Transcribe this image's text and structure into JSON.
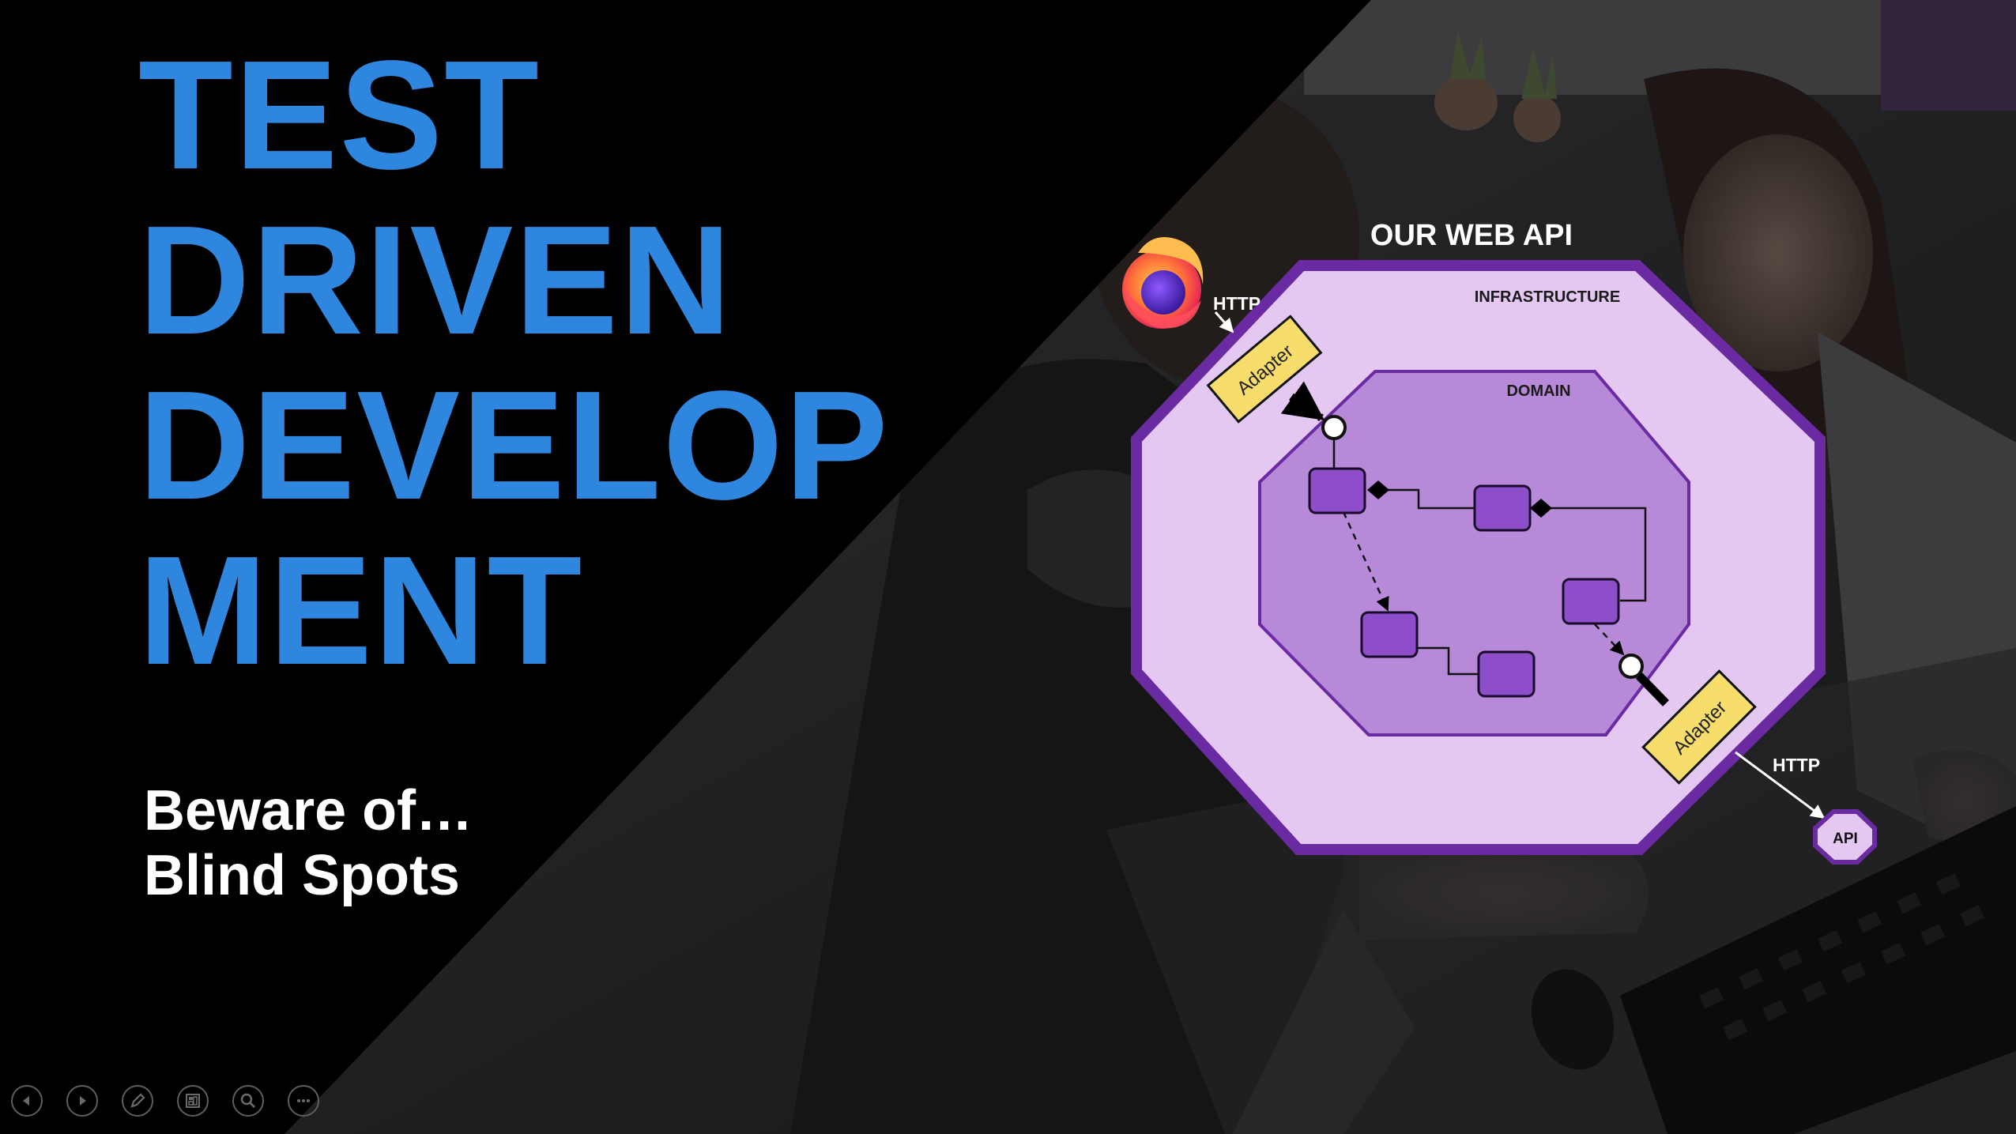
{
  "slide": {
    "title_lines": [
      "TEST",
      "DRIVEN",
      "DEVELOP",
      "MENT"
    ],
    "subtitle_lines": [
      "Beware of…",
      "Blind Spots"
    ]
  },
  "diagram": {
    "heading": "OUR WEB API",
    "outer_label": "INFRASTRUCTURE",
    "inner_label": "DOMAIN",
    "adapter_in_label": "Adapter",
    "adapter_out_label": "Adapter",
    "http_in_label": "HTTP",
    "http_out_label": "HTTP",
    "external_api_label": "API",
    "browser_icon": "firefox-icon"
  },
  "controls": [
    {
      "name": "previous-slide-button",
      "icon": "arrow-left-icon"
    },
    {
      "name": "next-slide-button",
      "icon": "arrow-right-icon"
    },
    {
      "name": "pen-button",
      "icon": "pen-icon"
    },
    {
      "name": "see-all-slides-button",
      "icon": "slides-grid-icon"
    },
    {
      "name": "zoom-button",
      "icon": "magnifier-icon"
    },
    {
      "name": "more-options-button",
      "icon": "more-icon"
    }
  ],
  "colors": {
    "title": "#2f86de",
    "outer_hexagon": "#e4c8f2",
    "outer_border": "#6a2ba2",
    "inner_hexagon": "#b78ad9",
    "domain_box": "#8f4ec9",
    "adapter": "#f7dd6c"
  }
}
